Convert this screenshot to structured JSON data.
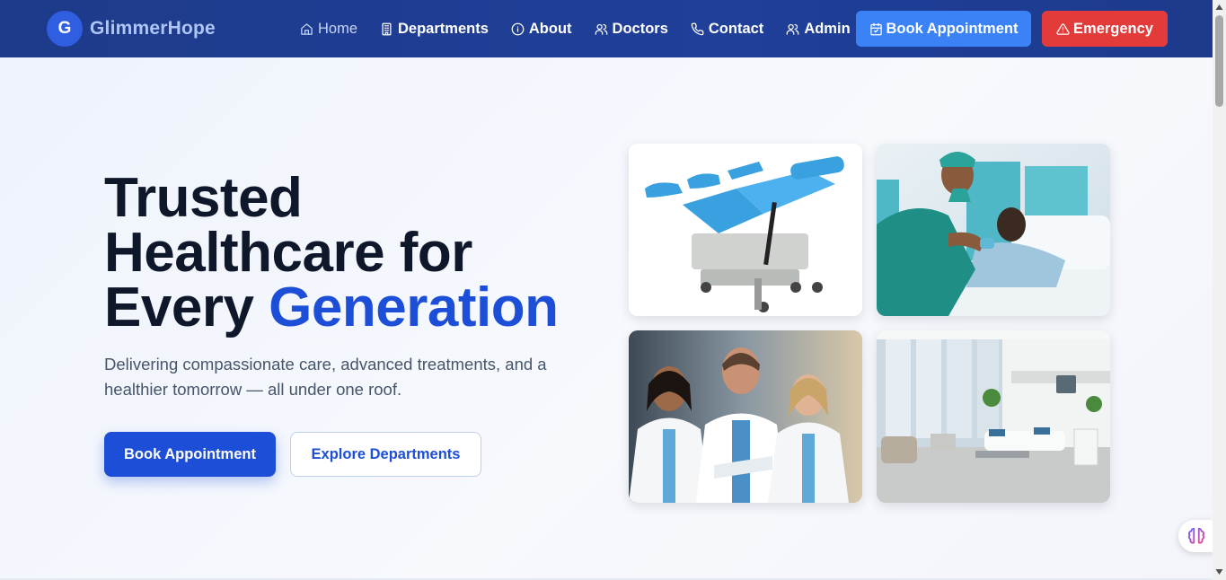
{
  "brand": {
    "logo_letter": "G",
    "name": "GlimmerHope"
  },
  "nav": {
    "links": [
      {
        "label": "Home",
        "icon": "home-icon",
        "active": true
      },
      {
        "label": "Departments",
        "icon": "building-icon"
      },
      {
        "label": "About",
        "icon": "info-icon"
      },
      {
        "label": "Doctors",
        "icon": "users-icon"
      },
      {
        "label": "Contact",
        "icon": "phone-icon"
      },
      {
        "label": "Admin",
        "icon": "users-icon"
      }
    ],
    "book_label": "Book Appointment",
    "emergency_label": "Emergency"
  },
  "hero": {
    "title_line1": "Trusted",
    "title_line2": "Healthcare for",
    "title_line3_plain": "Every ",
    "title_line3_accent": "Generation",
    "subtitle": "Delivering compassionate care, advanced treatments, and a healthier tomorrow — all under one roof.",
    "primary_cta": "Book Appointment",
    "secondary_cta": "Explore Departments",
    "images": [
      {
        "subject": "gynecological-exam-chair"
      },
      {
        "subject": "nurse-with-patient"
      },
      {
        "subject": "doctors-team"
      },
      {
        "subject": "hospital-room"
      }
    ]
  },
  "colors": {
    "nav_bg": "#1e3a8a",
    "accent_blue": "#1d4ed8",
    "book_button": "#3b82f6",
    "emergency_red": "#e33a3a"
  }
}
